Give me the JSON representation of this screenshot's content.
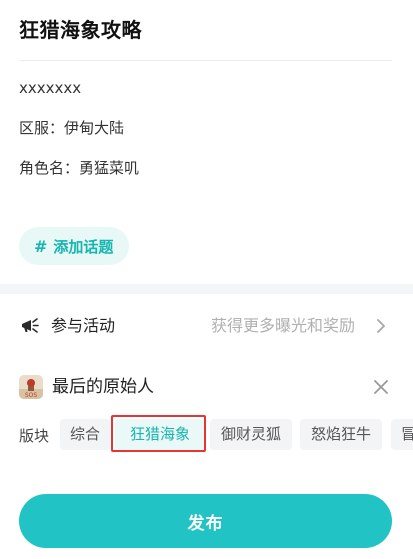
{
  "post": {
    "title": "狂猎海象攻略",
    "lines": [
      "xxxxxxx",
      "区服：伊甸大陆",
      "角色名：勇猛菜叽"
    ]
  },
  "topic": {
    "hash": "#",
    "label": "添加话题"
  },
  "activity": {
    "icon": "megaphone-icon",
    "label": "参与活动",
    "hint": "获得更多曝光和奖励"
  },
  "game": {
    "name": "最后的原始人",
    "icon_text": "SOS"
  },
  "board": {
    "label": "版块",
    "chips": [
      "综合",
      "狂猎海象",
      "御财灵狐",
      "怒焰狂牛",
      "冒"
    ],
    "selected": "狂猎海象"
  },
  "publish": {
    "label": "发布"
  },
  "colors": {
    "accent": "#22c3c4",
    "topic_bg": "#e7f8f7",
    "highlight": "#e53535"
  }
}
